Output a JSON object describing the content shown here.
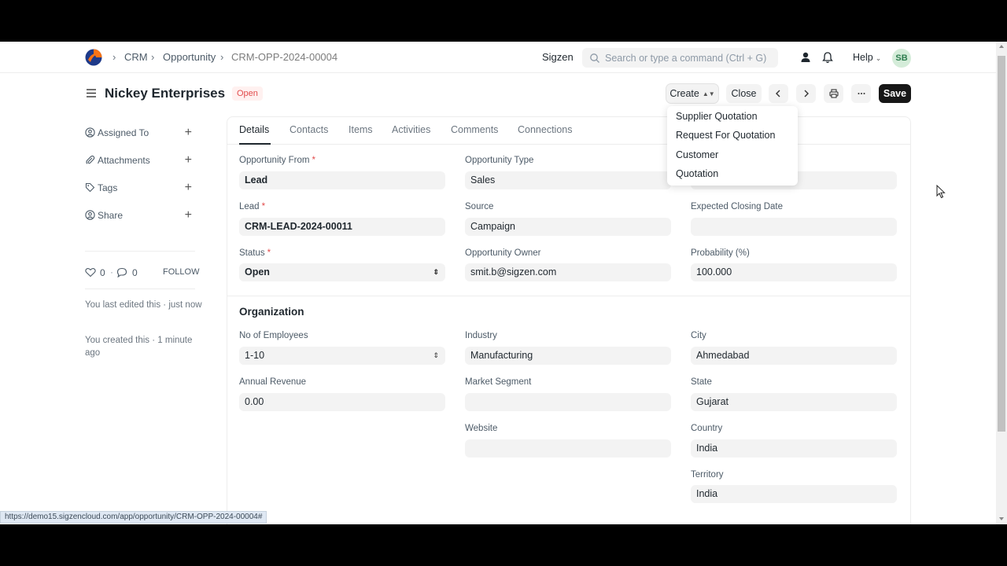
{
  "breadcrumbs": [
    "CRM",
    "Opportunity",
    "CRM-OPP-2024-00004"
  ],
  "navbar": {
    "company": "Sigzen",
    "search_placeholder": "Search or type a command (Ctrl + G)",
    "help_label": "Help",
    "avatar_initials": "SB"
  },
  "page": {
    "title": "Nickey Enterprises",
    "status": "Open"
  },
  "toolbar": {
    "create_label": "Create",
    "close_label": "Close",
    "save_label": "Save"
  },
  "create_menu": [
    "Supplier Quotation",
    "Request For Quotation",
    "Customer",
    "Quotation"
  ],
  "sidebar": {
    "items": [
      {
        "label": "Assigned To",
        "icon": "assign-icon"
      },
      {
        "label": "Attachments",
        "icon": "paperclip-icon"
      },
      {
        "label": "Tags",
        "icon": "tag-icon"
      },
      {
        "label": "Share",
        "icon": "share-icon"
      }
    ],
    "likes_count": "0",
    "comments_count": "0",
    "follow_label": "FOLLOW",
    "last_edited": "You last edited this · just now",
    "created": "You created this · 1 minute ago"
  },
  "tabs": [
    "Details",
    "Contacts",
    "Items",
    "Activities",
    "Comments",
    "Connections"
  ],
  "details": {
    "opportunity_from": {
      "label": "Opportunity From",
      "value": "Lead"
    },
    "opportunity_type": {
      "label": "Opportunity Type",
      "value": "Sales"
    },
    "lead": {
      "label": "Lead",
      "value": "CRM-LEAD-2024-00011"
    },
    "source": {
      "label": "Source",
      "value": "Campaign"
    },
    "expected_closing_date": {
      "label": "Expected Closing Date",
      "value": ""
    },
    "status": {
      "label": "Status",
      "value": "Open"
    },
    "opportunity_owner": {
      "label": "Opportunity Owner",
      "value": "smit.b@sigzen.com"
    },
    "probability": {
      "label": "Probability (%)",
      "value": "100.000"
    }
  },
  "organization": {
    "section_title": "Organization",
    "no_of_employees": {
      "label": "No of Employees",
      "value": "1-10"
    },
    "industry": {
      "label": "Industry",
      "value": "Manufacturing"
    },
    "city": {
      "label": "City",
      "value": "Ahmedabad"
    },
    "annual_revenue": {
      "label": "Annual Revenue",
      "value": "0.00"
    },
    "market_segment": {
      "label": "Market Segment",
      "value": ""
    },
    "state": {
      "label": "State",
      "value": "Gujarat"
    },
    "website": {
      "label": "Website",
      "value": ""
    },
    "country": {
      "label": "Country",
      "value": "India"
    },
    "territory": {
      "label": "Territory",
      "value": "India"
    }
  },
  "status_url": "https://demo15.sigzencloud.com/app/opportunity/CRM-OPP-2024-00004#",
  "colors": {
    "badge_bg": "#fff1f0",
    "badge_text": "#e24c4c",
    "save_bg": "#171717",
    "field_bg": "#f3f3f3"
  }
}
